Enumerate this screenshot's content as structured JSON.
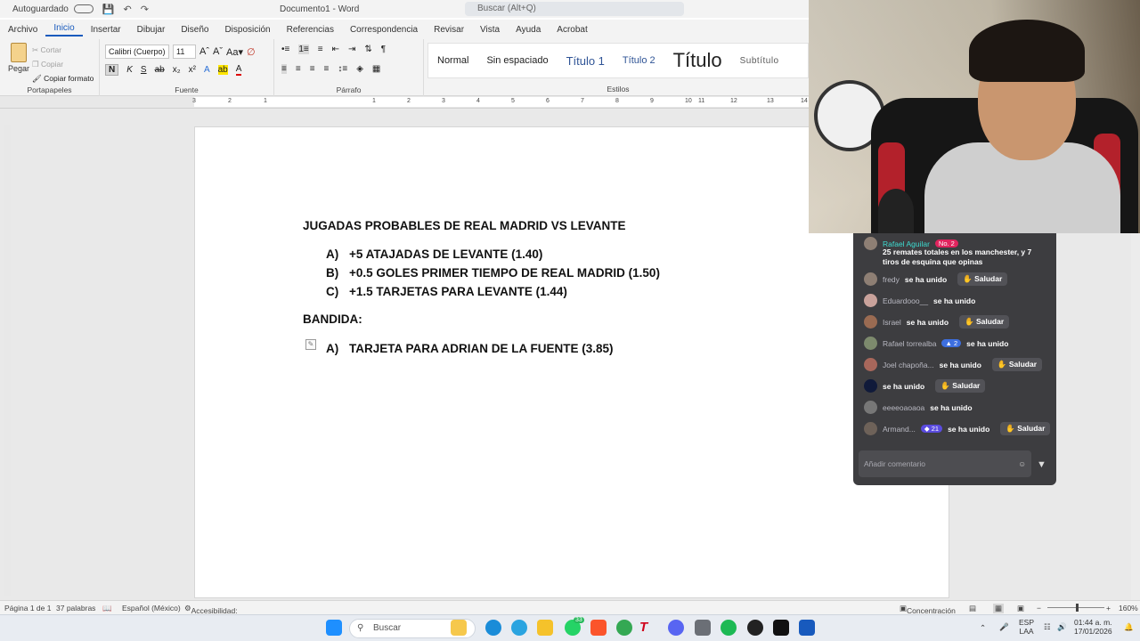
{
  "titlebar": {
    "autosave": "Autoguardado",
    "docname": "Documento1 - Word",
    "search": "Buscar (Alt+Q)"
  },
  "ribbon": {
    "tabs": [
      "Archivo",
      "Inicio",
      "Insertar",
      "Dibujar",
      "Diseño",
      "Disposición",
      "Referencias",
      "Correspondencia",
      "Revisar",
      "Vista",
      "Ayuda",
      "Acrobat"
    ],
    "active_tab": "Inicio",
    "clipboard": {
      "paste": "Pegar",
      "cut": "Cortar",
      "copy": "Copiar",
      "format_painter": "Copiar formato",
      "label": "Portapapeles"
    },
    "font": {
      "family": "Calibri (Cuerpo)",
      "size": "11",
      "label": "Fuente",
      "bold": "N",
      "italic": "K",
      "underline": "S"
    },
    "paragraph": {
      "label": "Párrafo"
    },
    "styles": {
      "label": "Estilos",
      "items": [
        "Normal",
        "Sin espaciado",
        "Título 1",
        "Título 2",
        "Título",
        "Subtítulo"
      ]
    }
  },
  "ruler": {
    "marks": [
      "3",
      "2",
      "1",
      "1",
      "2",
      "3",
      "4",
      "5",
      "6",
      "7",
      "8",
      "9",
      "10",
      "11",
      "12",
      "13",
      "14"
    ]
  },
  "document": {
    "heading": "JUGADAS PROBABLES DE REAL MADRID VS LEVANTE",
    "picks": [
      {
        "letter": "A)",
        "text": "+5 ATAJADAS DE LEVANTE (1.40)"
      },
      {
        "letter": "B)",
        "text": "+0.5 GOLES PRIMER TIEMPO DE REAL MADRID (1.50)"
      },
      {
        "letter": "C)",
        "text": "+1.5 TARJETAS PARA LEVANTE (1.44)"
      }
    ],
    "bandida_title": "BANDIDA:",
    "bandida_pick": {
      "letter": "A)",
      "text": "TARJETA PARA ADRIAN DE LA FUENTE (3.85)"
    }
  },
  "statusbar": {
    "page": "Página 1 de 1",
    "words": "37 palabras",
    "language": "Español (México)",
    "accessibility": "Accesibilidad: todo correcto",
    "focus": "Concentración",
    "zoom": "160%"
  },
  "taskbar": {
    "search": "Buscar",
    "lang": "ESP",
    "layout": "LAA",
    "time": "01:44 a. m.",
    "date": "17/01/2026",
    "whatsapp_badge": "33"
  },
  "chat": {
    "top_user": "Rafael Aguilar",
    "top_badge": "No. 2",
    "top_message": "25 remates totales en los manchester, y 7 tiros de esquina que opinas",
    "rows": [
      {
        "user": "fredy",
        "badge": "",
        "action": "se ha unido",
        "greet": "Saludar"
      },
      {
        "user": "Eduardooo__",
        "badge": "",
        "action": "se ha unido",
        "greet": ""
      },
      {
        "user": "Israel",
        "badge": "",
        "action": "se ha unido",
        "greet": "Saludar"
      },
      {
        "user": "Rafael torrealba",
        "badge": "2",
        "action": "se ha unido",
        "greet": ""
      },
      {
        "user": "Joel chapoña...",
        "badge": "",
        "action": "se ha unido",
        "greet": "Saludar"
      },
      {
        "user": "",
        "badge": "",
        "action": "se ha unido",
        "greet": "Saludar"
      },
      {
        "user": "eeeeoaoaoa",
        "badge": "",
        "action": "se ha unido",
        "greet": ""
      },
      {
        "user": "Armand...",
        "badge": "21",
        "action": "se ha unido",
        "greet": "Saludar"
      }
    ],
    "comment_placeholder": "Añadir comentario"
  }
}
